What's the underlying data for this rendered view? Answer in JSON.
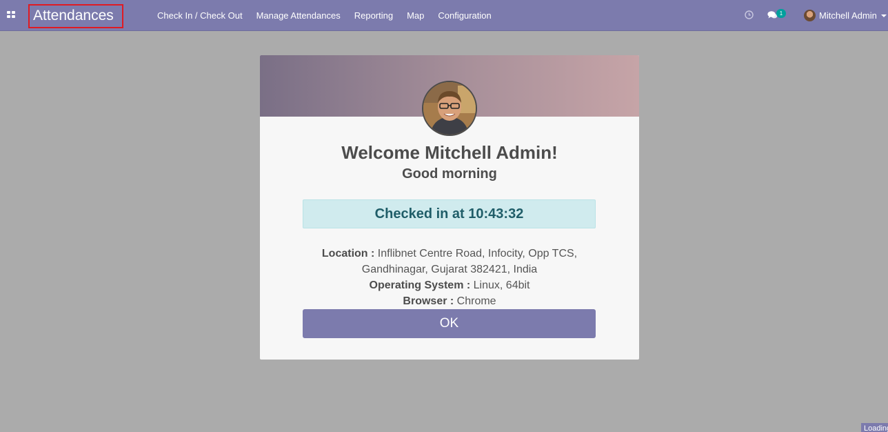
{
  "navbar": {
    "brand": "Attendances",
    "menu": [
      {
        "label": "Check In / Check Out"
      },
      {
        "label": "Manage Attendances"
      },
      {
        "label": "Reporting"
      },
      {
        "label": "Map"
      },
      {
        "label": "Configuration"
      }
    ],
    "systray": {
      "activity_icon": "clock-icon",
      "messaging_icon": "chat-icon",
      "messaging_badge": "1",
      "user_name": "Mitchell Admin"
    }
  },
  "card": {
    "welcome": "Welcome Mitchell Admin!",
    "greeting": "Good morning",
    "checked_in": "Checked in at 10:43:32",
    "location_label": "Location :",
    "location_value": "Inflibnet Centre Road, Infocity, Opp TCS, Gandhinagar, Gujarat 382421, India",
    "os_label": "Operating System :",
    "os_value": "Linux, 64bit",
    "browser_label": "Browser :",
    "browser_value": "Chrome",
    "ok_label": "OK"
  },
  "loading_text": "Loading",
  "colors": {
    "navbar": "#7c7bad",
    "background": "#ababab",
    "checked_box_bg": "#d0ebee",
    "checked_box_text": "#1f5d68",
    "badge": "#00a09d"
  }
}
